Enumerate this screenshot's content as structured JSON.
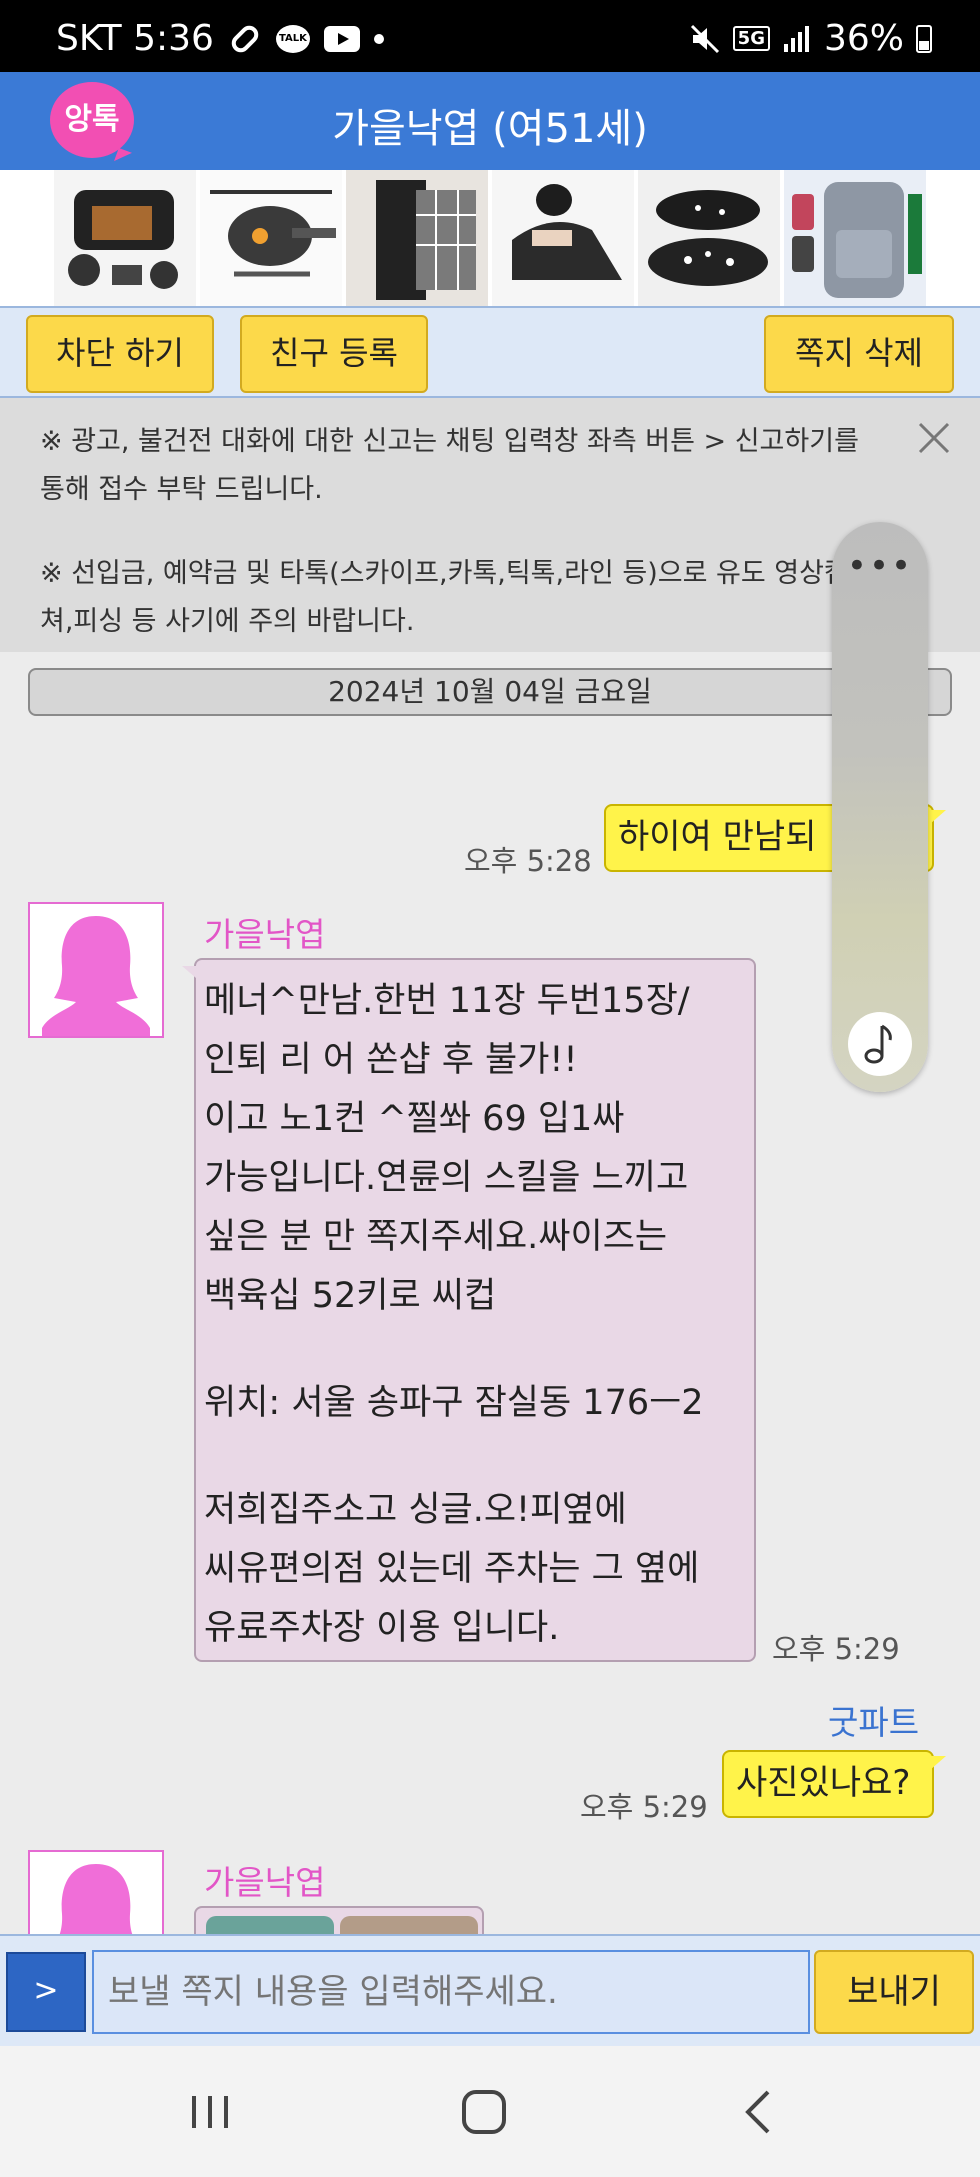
{
  "status_bar": {
    "carrier_time": "SKT 5:36",
    "talk_badge": "TALK",
    "network": "5G",
    "battery": "36%"
  },
  "header": {
    "logo_text": "앙톡",
    "title": "가을낙엽 (여51세)"
  },
  "ads": [
    "binoculars",
    "rc-helicopter",
    "plaid-shirt",
    "wedge-pillow",
    "slide-sandals",
    "backpack"
  ],
  "actions": {
    "block": "차단 하기",
    "add_friend": "친구 등록",
    "delete_note": "쪽지 삭제"
  },
  "notice": {
    "line1": "※ 광고, 불건전 대화에 대한 신고는 채팅 입력창 좌측 버튼 > 신고하기를 통해 접수 부탁 드립니다.",
    "line2": "※ 선입금, 예약금 및 타톡(스카이프,카톡,틱톡,라인 등)으로 유도 영상캡쳐,피싱 등 사기에 주의 바랍니다."
  },
  "date_label": "2024년 10월 04일 금요일",
  "messages": [
    {
      "from": "me",
      "text": "하이여 만남되",
      "time": "오후 5:28"
    },
    {
      "from": "them",
      "sender": "가을낙엽",
      "lines": [
        "메너^만남.한번 11장 두번15장/",
        "인퇴 리 어 쏜샵 후 불가!!",
        "이고 노1컨 ^찔쏴 69 입1싸",
        "가능입니다.연륜의 스킬을 느끼고",
        "싶은 분 만 쪽지주세요.싸이즈는",
        "백육십 52키로 씨컵",
        "",
        "위치: 서울 송파구 잠실동 176ㅡ2",
        "",
        "저희집주소고 싱글.오!피옆에",
        "씨유편의점 있는데 주차는 그 옆에",
        "유료주차장 이용 입니다."
      ],
      "time": "오후 5:29"
    },
    {
      "from": "me",
      "sender": "굿파트",
      "text": "사진있나요?",
      "time": "오후 5:29"
    },
    {
      "from": "them",
      "sender": "가을낙엽",
      "text": ""
    }
  ],
  "floating_panel": {
    "more": "•••"
  },
  "composer": {
    "menu_label": ">",
    "placeholder": "보낼 쪽지 내용을 입력해주세요.",
    "send_label": "보내기"
  }
}
